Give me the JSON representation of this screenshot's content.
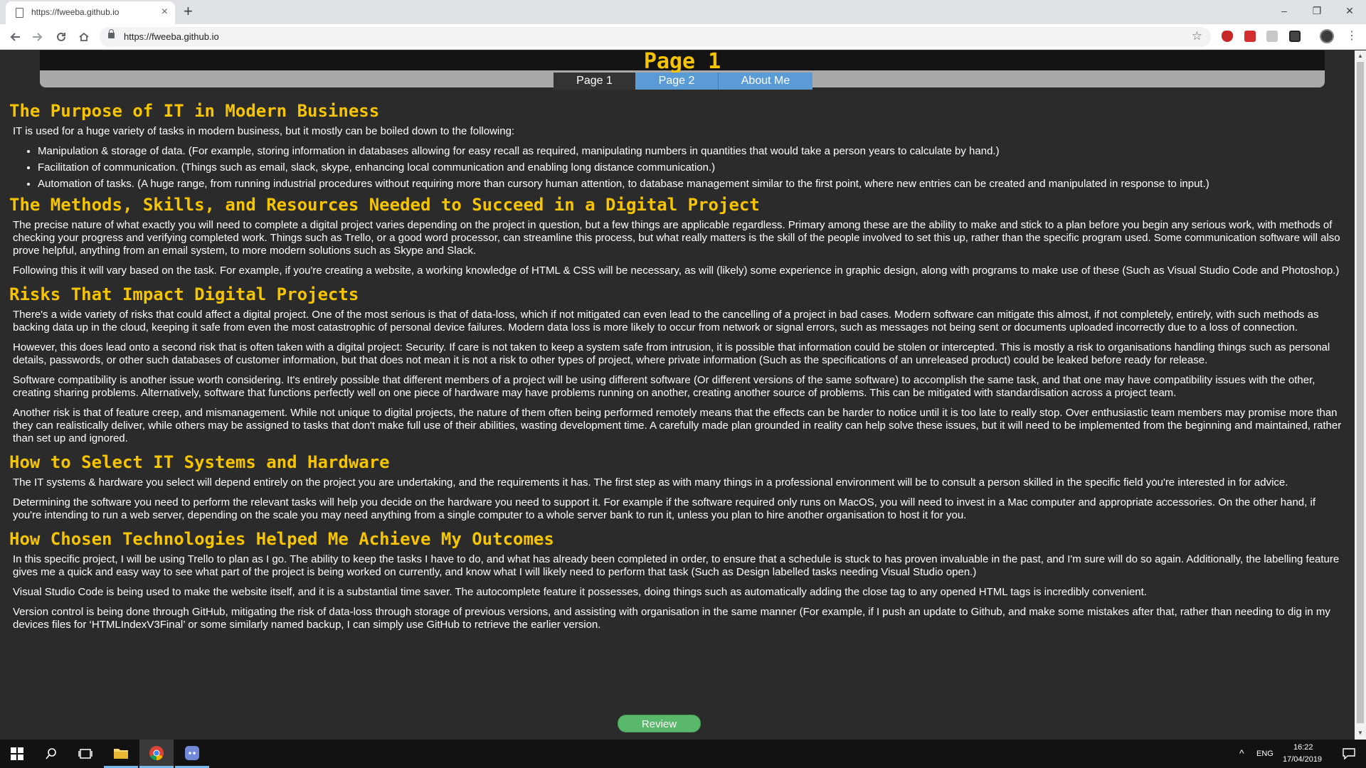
{
  "browser": {
    "tab_title": "https://fweeba.github.io",
    "url": "https://fweeba.github.io",
    "tab_close": "×",
    "new_tab": "+",
    "window_controls": {
      "minimize": "–",
      "restore": "❐",
      "close": "✕"
    }
  },
  "site": {
    "page_title": "Page 1",
    "nav": [
      "Page 1",
      "Page 2",
      "About Me"
    ]
  },
  "sections": {
    "purpose": {
      "heading": "The Purpose of IT in Modern Business",
      "intro": "IT is used for a huge variety of tasks in modern business, but it mostly can be boiled down to the following:",
      "bullets": [
        "Manipulation & storage of data. (For example, storing information in databases allowing for easy recall as required, manipulating numbers in quantities that would take a person years to calculate by hand.)",
        "Facilitation of communication. (Things such as email, slack, skype, enhancing local communication and enabling long distance communication.)",
        "Automation of tasks. (A huge range, from running industrial procedures without requiring more than cursory human attention, to database management similar to the first point, where new entries can be created and manipulated in response to input.)"
      ]
    },
    "methods": {
      "heading": "The Methods, Skills, and Resources Needed to Succeed in a Digital Project",
      "paragraphs": [
        "The precise nature of what exactly you will need to complete a digital project varies depending on the project in question, but a few things are applicable regardless. Primary among these are the ability to make and stick to a plan before you begin any serious work, with methods of checking your progress and verifying completed work. Things such as Trello, or a good word processor, can streamline this process, but what really matters is the skill of the people involved to set this up, rather than the specific program used. Some communication software will also prove helpful, anything from an email system, to more modern solutions such as Skype and Slack.",
        "Following this it will vary based on the task. For example, if you're creating a website, a working knowledge of HTML & CSS will be necessary, as will (likely) some experience in graphic design, along with programs to make use of these (Such as Visual Studio Code and Photoshop.)"
      ]
    },
    "risks": {
      "heading": "Risks That Impact Digital Projects",
      "paragraphs": [
        "There's a wide variety of risks that could affect a digital project. One of the most serious is that of data-loss, which if not mitigated can even lead to the cancelling of a project in bad cases. Modern software can mitigate this almost, if not completely, entirely, with such methods as backing data up in the cloud, keeping it safe from even the most catastrophic of personal device failures. Modern data loss is more likely to occur from network or signal errors, such as messages not being sent or documents uploaded incorrectly due to a loss of connection.",
        "However, this does lead onto a second risk that is often taken with a digital project: Security. If care is not taken to keep a system safe from intrusion, it is possible that information could be stolen or intercepted. This is mostly a risk to organisations handling things such as personal details, passwords, or other such databases of customer information, but that does not mean it is not a risk to other types of project, where private information (Such as the specifications of an unreleased product) could be leaked before ready for release.",
        "Software compatibility is another issue worth considering. It's entirely possible that different members of a project will be using different software (Or different versions of the same software) to accomplish the same task, and that one may have compatibility issues with the other, creating sharing problems. Alternatively, software that functions perfectly well on one piece of hardware may have problems running on another, creating another source of problems. This can be mitigated with standardisation across a project team.",
        "Another risk is that of feature creep, and mismanagement. While not unique to digital projects, the nature of them often being performed remotely means that the effects can be harder to notice until it is too late to really stop. Over enthusiastic team members may promise more than they can realistically deliver, while others may be assigned to tasks that don't make full use of their abilities, wasting development time. A carefully made plan grounded in reality can help solve these issues, but it will need to be implemented from the beginning and maintained, rather than set up and ignored."
      ]
    },
    "select": {
      "heading": "How to Select IT Systems and Hardware",
      "paragraphs": [
        "The IT systems & hardware you select will depend entirely on the project you are undertaking, and the requirements it has. The first step as with many things in a professional environment will be to consult a person skilled in the specific field you're interested in for advice.",
        "Determining the software you need to perform the relevant tasks will help you decide on the hardware you need to support it. For example if the software required only runs on MacOS, you will need to invest in a Mac computer and appropriate accessories. On the other hand, if you're intending to run a web server, depending on the scale you may need anything from a single computer to a whole server bank to run it, unless you plan to hire another organisation to host it for you."
      ]
    },
    "chosen": {
      "heading": "How Chosen Technologies Helped Me Achieve My Outcomes",
      "paragraphs": [
        "In this specific project, I will be using Trello to plan as I go. The ability to keep the tasks I have to do, and what has already been completed in order, to ensure that a schedule is stuck to has proven invaluable in the past, and I'm sure will do so again. Additionally, the labelling feature gives me a quick and easy way to see what part of the project is being worked on currently, and know what I will likely need to perform that task (Such as Design labelled tasks needing Visual Studio open.)",
        "Visual Studio Code is being used to make the website itself, and it is a substantial time saver. The autocomplete feature it possesses, doing things such as automatically adding the close tag to any opened HTML tags is incredibly convenient.",
        "Version control is being done through GitHub, mitigating the risk of data-loss through storage of previous versions, and assisting with organisation in the same manner (For example, if I push an update to Github, and make some mistakes after that, rather than needing to dig in my devices files for ‘HTMLIndexV3Final’ or some similarly named backup, I can simply use GitHub to retrieve the earlier version."
      ]
    }
  },
  "review_button": "Review",
  "taskbar": {
    "language": "ENG",
    "time": "16:22",
    "date": "17/04/2019",
    "tray_arrow": "^"
  },
  "colors": {
    "page_background": "#2b2b2b",
    "heading_accent": "#f6c400",
    "nav_link": "#5b9bd5",
    "review_button": "#59b86a"
  }
}
